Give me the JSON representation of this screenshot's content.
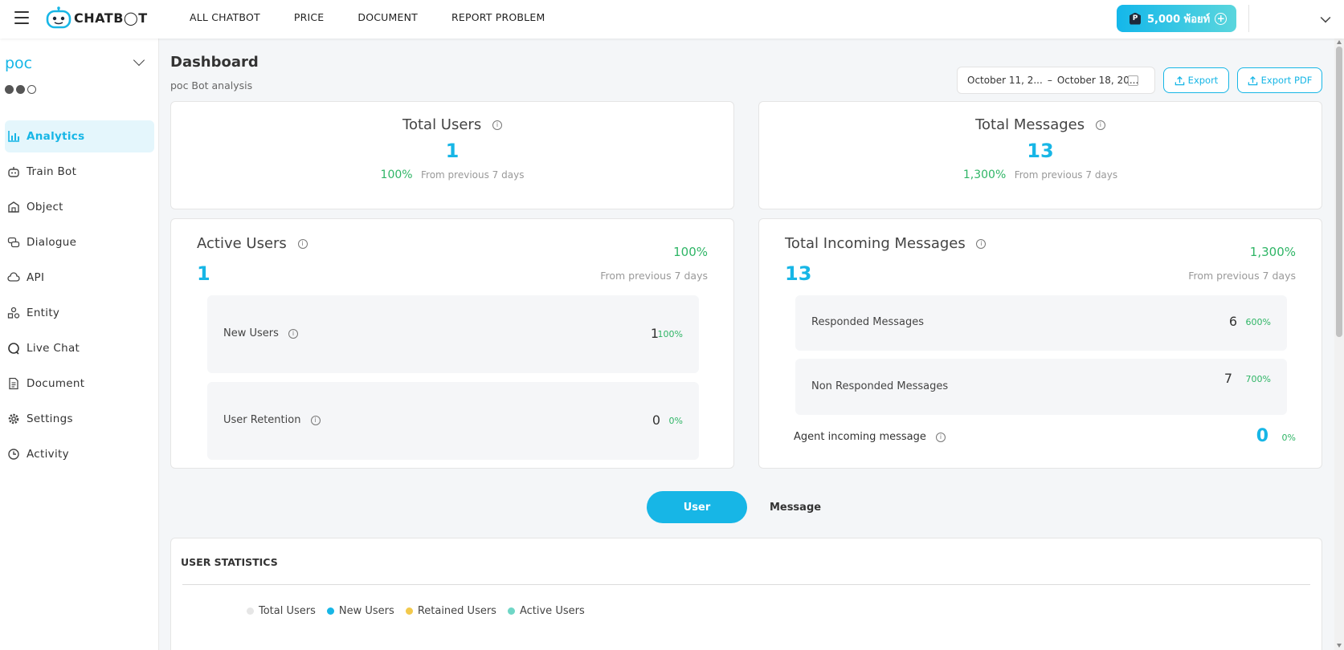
{
  "brand": {
    "logo_text": "CHATB◯T"
  },
  "topnav": [
    "ALL CHATBOT",
    "PRICE",
    "DOCUMENT",
    "REPORT PROBLEM"
  ],
  "points": {
    "icon_letter": "P",
    "label": "5,000 พ้อยท์",
    "plus": "+"
  },
  "sidebar": {
    "bot_name": "poc",
    "channels": [
      "messenger-icon",
      "line-icon",
      "whatsapp-icon"
    ],
    "items": [
      {
        "label": "Analytics",
        "icon": "bar-chart-icon",
        "active": true
      },
      {
        "label": "Train Bot",
        "icon": "robot-icon"
      },
      {
        "label": "Object",
        "icon": "store-icon"
      },
      {
        "label": "Dialogue",
        "icon": "chat-bubbles-icon"
      },
      {
        "label": "API",
        "icon": "cloud-icon"
      },
      {
        "label": "Entity",
        "icon": "shapes-icon"
      },
      {
        "label": "Live Chat",
        "icon": "chat-bubble-icon"
      },
      {
        "label": "Document",
        "icon": "document-icon"
      },
      {
        "label": "Settings",
        "icon": "gear-icon"
      },
      {
        "label": "Activity",
        "icon": "clock-icon"
      }
    ]
  },
  "header": {
    "title": "Dashboard",
    "subtitle": "poc Bot analysis",
    "date_start": "October 11, 2...",
    "date_sep": "–",
    "date_end": "October 18, 20...",
    "export_label": "Export",
    "export_pdf_label": "Export PDF"
  },
  "total_users": {
    "title": "Total Users",
    "value": "1",
    "pct": "100%",
    "note": "From previous 7 days"
  },
  "total_messages": {
    "title": "Total Messages",
    "value": "13",
    "pct": "1,300%",
    "note": "From previous 7 days"
  },
  "active_users": {
    "title": "Active Users",
    "value": "1",
    "pct": "100%",
    "note": "From previous 7 days",
    "new_users": {
      "label": "New Users",
      "value": "1",
      "pct": "100%"
    },
    "retention": {
      "label": "User Retention",
      "value": "0",
      "pct": "0%"
    }
  },
  "incoming": {
    "title": "Total Incoming Messages",
    "value": "13",
    "pct": "1,300%",
    "note": "From previous 7 days",
    "responded": {
      "label": "Responded Messages",
      "value": "6",
      "pct": "600%"
    },
    "non_responded": {
      "label": "Non Responded Messages",
      "value": "7",
      "pct": "700%"
    },
    "agent": {
      "label": "Agent incoming message",
      "value": "0",
      "pct": "0%"
    }
  },
  "tabs": {
    "user": "User",
    "message": "Message"
  },
  "user_statistics": {
    "title": "USER STATISTICS",
    "legend": [
      {
        "label": "Total Users",
        "color": "#e6e6e6"
      },
      {
        "label": "New Users",
        "color": "#17b6e6"
      },
      {
        "label": "Retained Users",
        "color": "#f2c94c"
      },
      {
        "label": "Active Users",
        "color": "#6fd6c6"
      }
    ]
  },
  "colors": {
    "accent": "#17b6e6",
    "positive": "#2fb566"
  }
}
